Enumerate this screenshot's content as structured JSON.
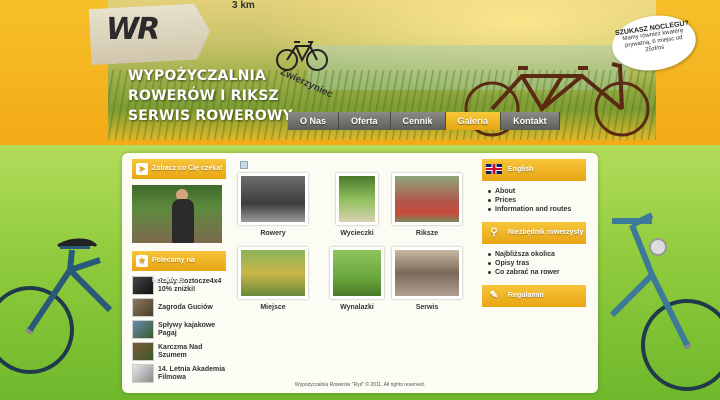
{
  "header": {
    "logo_text": "WR",
    "sign_distance": "3 km",
    "sign_place": "Zwierzyniec",
    "title_lines": [
      "Wypożyczalnia",
      "Rowerów i Riksz",
      "Serwis Rowerowy"
    ],
    "promo": {
      "title": "SZUKASZ NOCLEGU?",
      "text": "Mamy również kwaterę prywatną, 6 miejsc od 25zł/os"
    }
  },
  "nav": {
    "items": [
      {
        "label": "O Nas"
      },
      {
        "label": "Oferta"
      },
      {
        "label": "Cennik"
      },
      {
        "label": "Galeria",
        "active": true
      },
      {
        "label": "Kontakt"
      }
    ]
  },
  "left": {
    "teaser_title": "Zobacz co Cię czeka!",
    "recommend_title": "Polecamy na Roztoczu",
    "recommend": [
      {
        "label": "Rajdy Roztocze4x4 10% zniżki!"
      },
      {
        "label": "Zagroda Guciów"
      },
      {
        "label": "Spływy kajakowe Pagaj"
      },
      {
        "label": "Karczma Nad Szumem"
      },
      {
        "label": "14. Letnia Akademia Filmowa"
      }
    ]
  },
  "gallery": {
    "items": [
      {
        "caption": "Rowery"
      },
      {
        "caption": "Wycieczki"
      },
      {
        "caption": "Riksze"
      },
      {
        "caption": "Miejsce"
      },
      {
        "caption": "Wynalazki"
      },
      {
        "caption": "Serwis"
      }
    ]
  },
  "right": {
    "english_title": "English",
    "english_links": [
      "About",
      "Prices",
      "Information and routes"
    ],
    "guide_title": "Niezbędnik rowerzysty",
    "guide_links": [
      "Najbliższa okolica",
      "Opisy tras",
      "Co zabrać na rower"
    ],
    "rules_title": "Regulamin"
  },
  "footer": {
    "text": "Wypożyczalnia Rowerów \"Ryś\" © 2011. All rights reserved."
  },
  "colors": {
    "accent": "#f2aa16",
    "nav_bg": "#5d5d5a",
    "green": "#8fcb3c"
  }
}
